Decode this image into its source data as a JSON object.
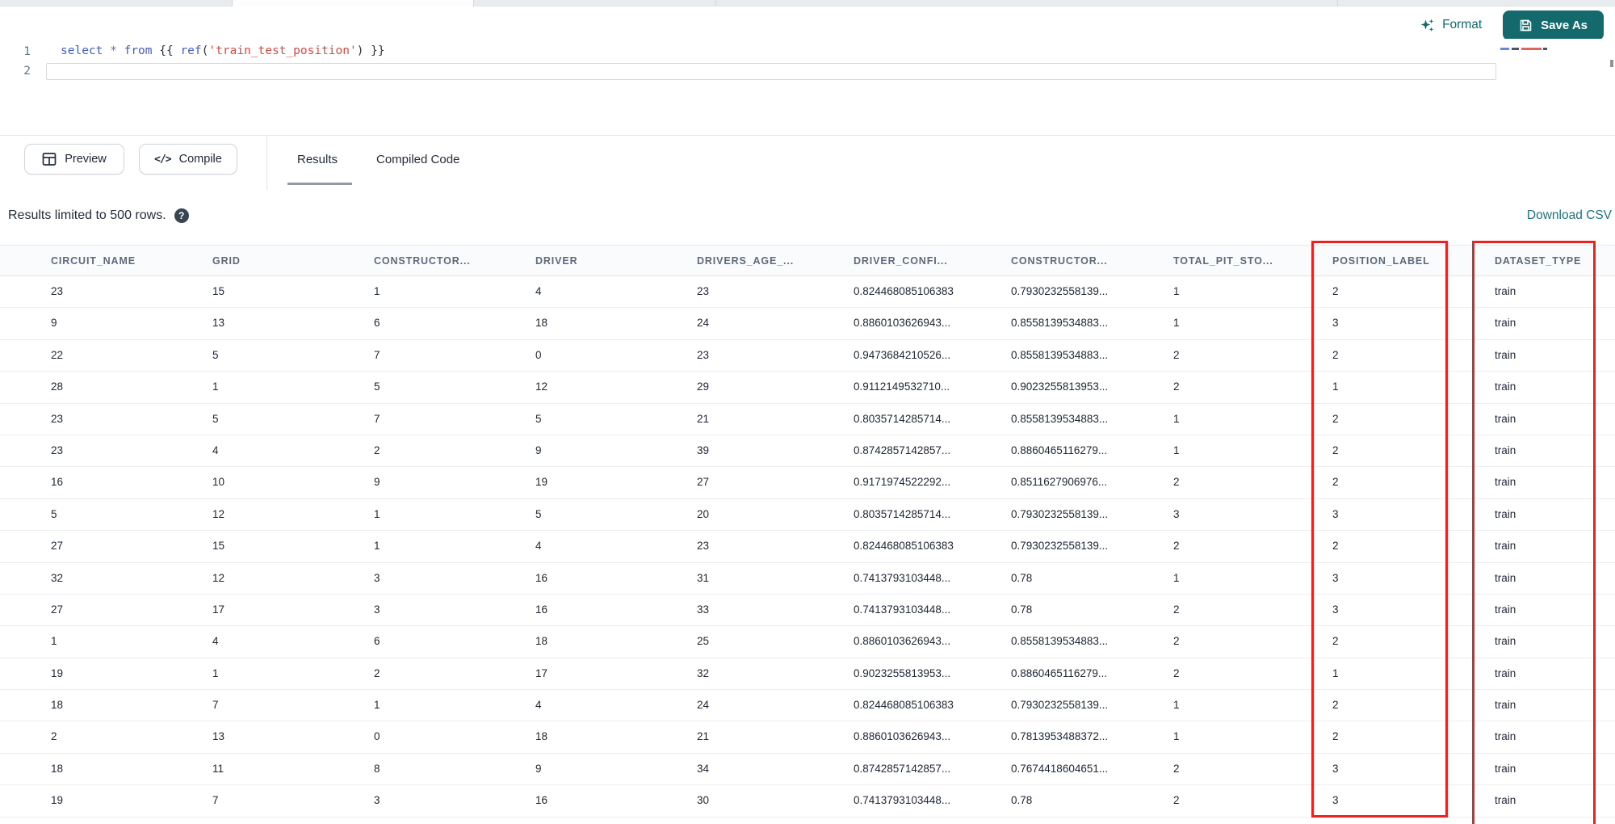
{
  "editor": {
    "line_numbers": [
      "1",
      "2"
    ],
    "code_tokens": [
      {
        "text": "select",
        "type": "keyword"
      },
      {
        "text": " ",
        "type": "plain"
      },
      {
        "text": "*",
        "type": "operator"
      },
      {
        "text": " ",
        "type": "plain"
      },
      {
        "text": "from",
        "type": "keyword"
      },
      {
        "text": " {{ ",
        "type": "plain"
      },
      {
        "text": "ref",
        "type": "function"
      },
      {
        "text": "(",
        "type": "plain"
      },
      {
        "text": "'train_test_position'",
        "type": "string"
      },
      {
        "text": ") }}",
        "type": "plain"
      }
    ],
    "format_label": "Format",
    "save_as_label": "Save As"
  },
  "toolbar": {
    "preview_label": "Preview",
    "compile_label": "Compile",
    "compile_glyph": "</>",
    "tabs": [
      {
        "label": "Results",
        "active": true
      },
      {
        "label": "Compiled Code",
        "active": false
      }
    ]
  },
  "results_bar": {
    "info": "Results limited to 500 rows.",
    "help_glyph": "?",
    "download_label": "Download CSV"
  },
  "table": {
    "columns": [
      "CIRCUIT_NAME",
      "GRID",
      "CONSTRUCTOR...",
      "DRIVER",
      "DRIVERS_AGE_...",
      "DRIVER_CONFI...",
      "CONSTRUCTOR...",
      "TOTAL_PIT_STO...",
      "POSITION_LABEL",
      "DATASET_TYPE"
    ],
    "highlighted_columns": [
      "POSITION_LABEL",
      "DATASET_TYPE"
    ],
    "rows": [
      [
        "23",
        "15",
        "1",
        "4",
        "23",
        "0.824468085106383",
        "0.7930232558139...",
        "1",
        "2",
        "train"
      ],
      [
        "9",
        "13",
        "6",
        "18",
        "24",
        "0.8860103626943...",
        "0.8558139534883...",
        "1",
        "3",
        "train"
      ],
      [
        "22",
        "5",
        "7",
        "0",
        "23",
        "0.9473684210526...",
        "0.8558139534883...",
        "2",
        "2",
        "train"
      ],
      [
        "28",
        "1",
        "5",
        "12",
        "29",
        "0.9112149532710...",
        "0.9023255813953...",
        "2",
        "1",
        "train"
      ],
      [
        "23",
        "5",
        "7",
        "5",
        "21",
        "0.8035714285714...",
        "0.8558139534883...",
        "1",
        "2",
        "train"
      ],
      [
        "23",
        "4",
        "2",
        "9",
        "39",
        "0.8742857142857...",
        "0.8860465116279...",
        "1",
        "2",
        "train"
      ],
      [
        "16",
        "10",
        "9",
        "19",
        "27",
        "0.9171974522292...",
        "0.8511627906976...",
        "2",
        "2",
        "train"
      ],
      [
        "5",
        "12",
        "1",
        "5",
        "20",
        "0.8035714285714...",
        "0.7930232558139...",
        "3",
        "3",
        "train"
      ],
      [
        "27",
        "15",
        "1",
        "4",
        "23",
        "0.824468085106383",
        "0.7930232558139...",
        "2",
        "2",
        "train"
      ],
      [
        "32",
        "12",
        "3",
        "16",
        "31",
        "0.7413793103448...",
        "0.78",
        "1",
        "3",
        "train"
      ],
      [
        "27",
        "17",
        "3",
        "16",
        "33",
        "0.7413793103448...",
        "0.78",
        "2",
        "3",
        "train"
      ],
      [
        "1",
        "4",
        "6",
        "18",
        "25",
        "0.8860103626943...",
        "0.8558139534883...",
        "2",
        "2",
        "train"
      ],
      [
        "19",
        "1",
        "2",
        "17",
        "32",
        "0.9023255813953...",
        "0.8860465116279...",
        "2",
        "1",
        "train"
      ],
      [
        "18",
        "7",
        "1",
        "4",
        "24",
        "0.824468085106383",
        "0.7930232558139...",
        "1",
        "2",
        "train"
      ],
      [
        "2",
        "13",
        "0",
        "18",
        "21",
        "0.8860103626943...",
        "0.7813953488372...",
        "1",
        "2",
        "train"
      ],
      [
        "18",
        "11",
        "8",
        "9",
        "34",
        "0.8742857142857...",
        "0.7674418604651...",
        "2",
        "3",
        "train"
      ],
      [
        "19",
        "7",
        "3",
        "16",
        "30",
        "0.7413793103448...",
        "0.78",
        "2",
        "3",
        "train"
      ]
    ]
  },
  "colors": {
    "accent_teal": "#14696d",
    "highlight_red": "#ef2020",
    "keyword_blue": "#415fc9",
    "string_red": "#dd4a42"
  }
}
